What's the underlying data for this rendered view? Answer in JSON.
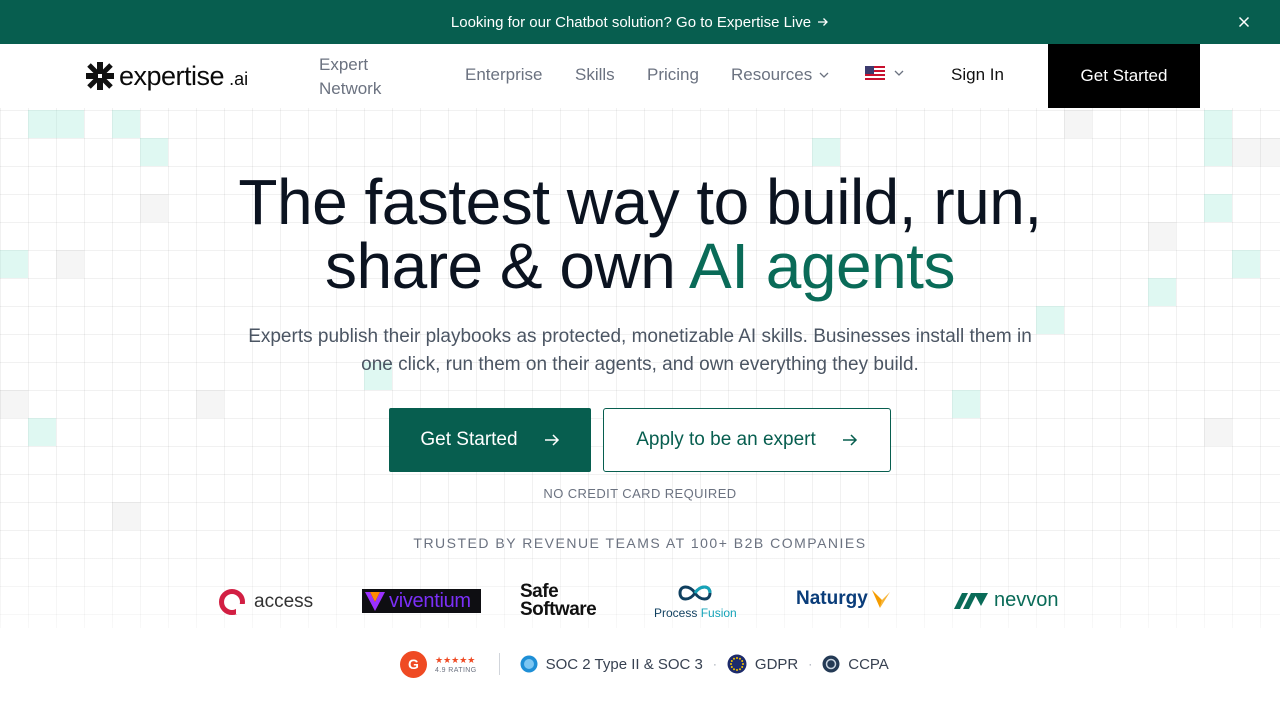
{
  "announcement": {
    "text": "Looking for our Chatbot solution? Go to Expertise Live",
    "link_icon": "arrow-right-icon",
    "close_icon": "close-icon"
  },
  "nav": {
    "logo_word": "expertise",
    "logo_suffix": ".ai",
    "expert_line1": "Expert",
    "expert_line2": "Network",
    "enterprise": "Enterprise",
    "skills": "Skills",
    "pricing": "Pricing",
    "resources": "Resources",
    "language_icon": "us-flag-icon",
    "sign_in": "Sign In",
    "cta": "Get Started"
  },
  "hero": {
    "headline_line1": "The fastest way to build, run,",
    "headline_line2_plain": "share & own ",
    "headline_line2_accent": "AI agents",
    "subhead": "Experts publish their playbooks as protected, monetizable AI skills. Businesses install them in one click, run them on their agents, and own everything they build.",
    "primary_cta": "Get Started",
    "secondary_cta": "Apply to be an expert",
    "note": "NO CREDIT CARD REQUIRED",
    "trusted": "TRUSTED BY REVENUE TEAMS AT 100+ B2B COMPANIES"
  },
  "logos": {
    "access": "access",
    "viventium": "viventium",
    "safe_line1": "Safe",
    "safe_line2": "Software",
    "process_fusion_a": "Process ",
    "process_fusion_b": "Fusion",
    "naturgy": "Naturgy",
    "nevvon": "nevvon"
  },
  "badges": {
    "g2_letter": "G",
    "g2_stars": "★★★★★",
    "g2_rating": "4.9 RATING",
    "soc": "SOC 2 Type II & SOC 3",
    "gdpr": "GDPR",
    "ccpa": "CCPA",
    "separator": "·"
  },
  "colors": {
    "brand": "#075e4f",
    "accent_text": "#0a6b58",
    "cta_black": "#000000",
    "g2": "#ef4a23"
  }
}
